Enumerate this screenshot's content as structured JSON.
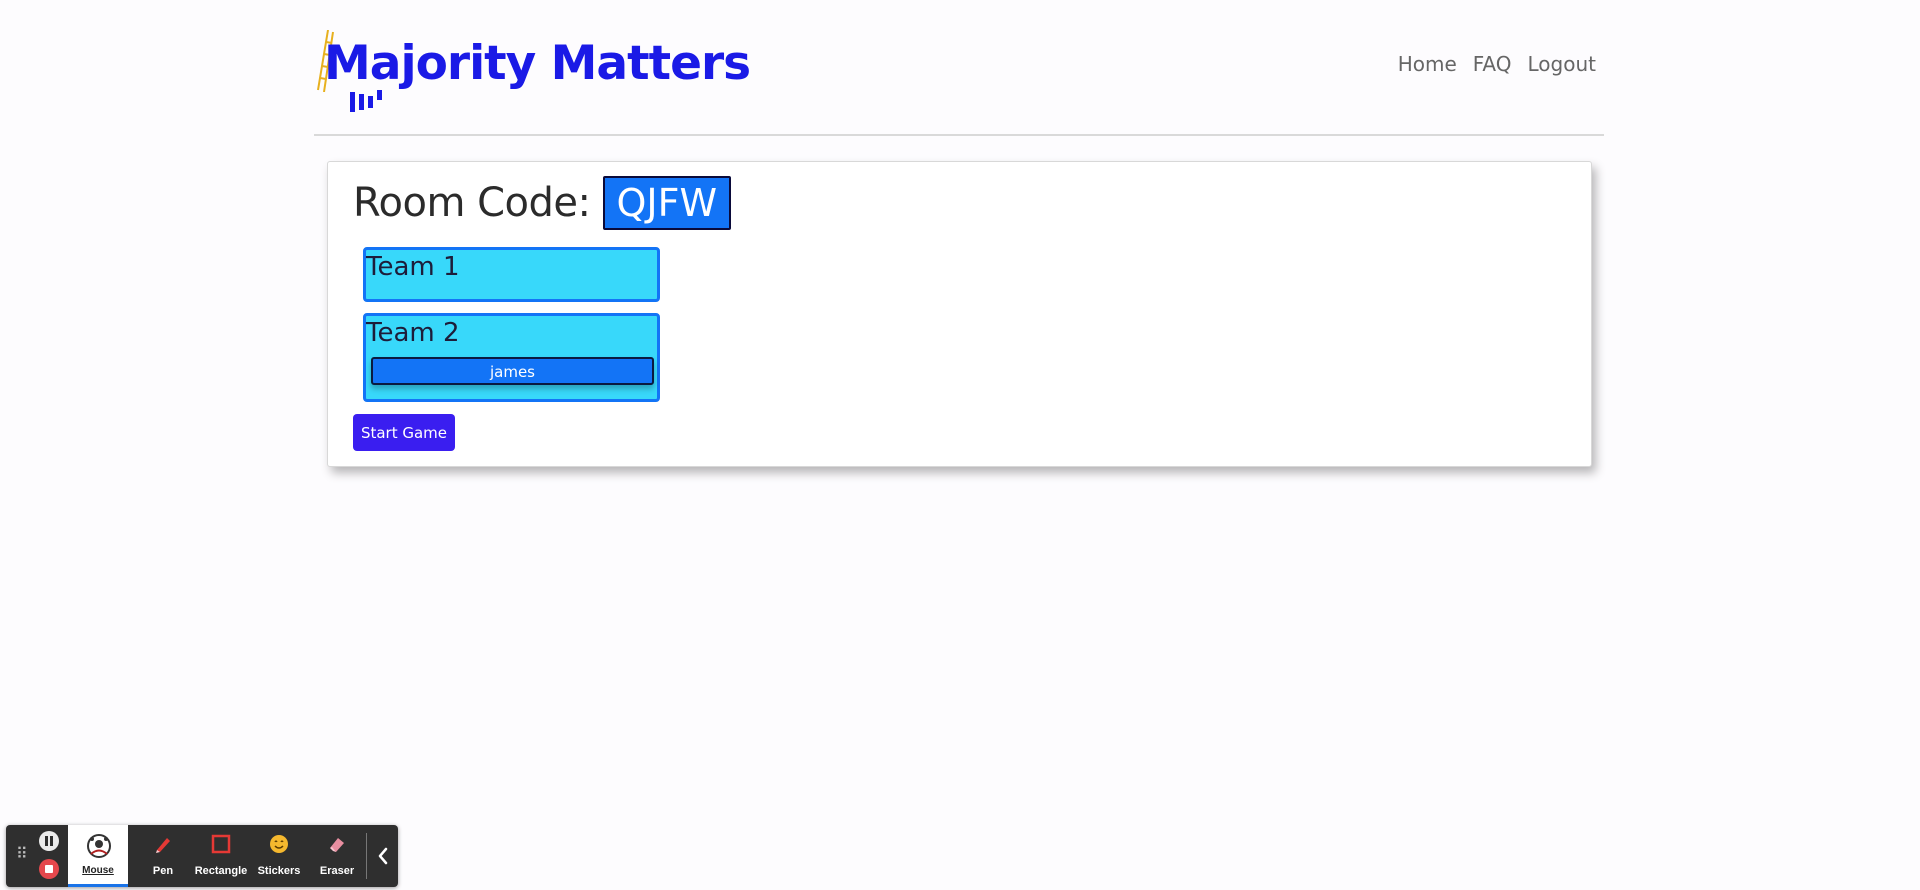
{
  "header": {
    "logo_text": "Majority Matters",
    "nav": [
      {
        "label": "Home"
      },
      {
        "label": "FAQ"
      },
      {
        "label": "Logout"
      }
    ]
  },
  "room": {
    "label": "Room Code:",
    "code": "QJFW"
  },
  "teams": [
    {
      "name": "Team 1",
      "players": []
    },
    {
      "name": "Team 2",
      "players": [
        "james"
      ]
    }
  ],
  "actions": {
    "start_label": "Start Game"
  },
  "toolbar": {
    "active_label": "Mouse",
    "tools": [
      {
        "label": "Pen",
        "icon": "pen-icon"
      },
      {
        "label": "Rectangle",
        "icon": "rectangle-icon"
      },
      {
        "label": "Stickers",
        "icon": "sticker-icon"
      },
      {
        "label": "Eraser",
        "icon": "eraser-icon"
      }
    ]
  },
  "colors": {
    "brand": "#1a1ae6",
    "room_code_bg": "#1374f6",
    "team_bg": "#38d8fa",
    "start_button": "#3a1ef0"
  }
}
